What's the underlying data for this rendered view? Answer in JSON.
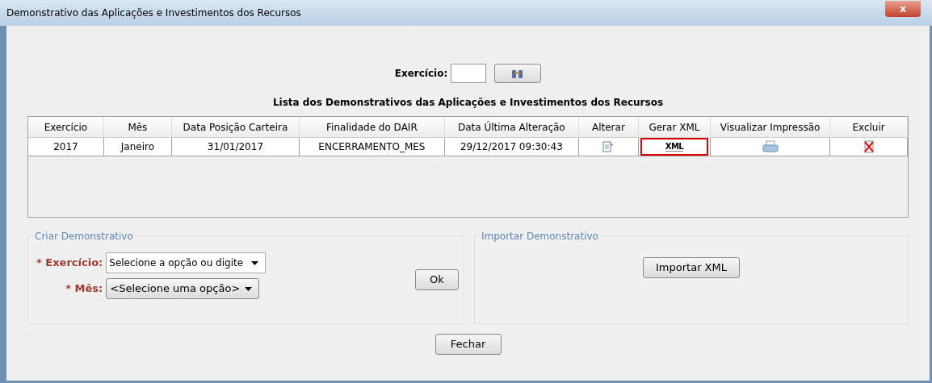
{
  "window": {
    "title": "Demonstrativo das Aplicações e Investimentos dos Recursos",
    "close": "x"
  },
  "filter": {
    "label": "Exercício:"
  },
  "table": {
    "title": "Lista dos Demonstrativos das Aplicações e Investimentos dos Recursos",
    "columns": [
      "Exercício",
      "Mês",
      "Data Posição Carteira",
      "Finalidade do DAIR",
      "Data Última Alteração",
      "Alterar",
      "Gerar XML",
      "Visualizar Impressão",
      "Excluir"
    ],
    "rows": [
      {
        "cells": [
          {
            "kind": "text",
            "text": "2017",
            "highlighted": false
          },
          {
            "kind": "text",
            "text": "Janeiro",
            "highlighted": false
          },
          {
            "kind": "text",
            "text": "31/01/2017",
            "highlighted": false
          },
          {
            "kind": "text",
            "text": "ENCERRAMENTO_MES",
            "highlighted": false
          },
          {
            "kind": "text",
            "text": "29/12/2017 09:30:43",
            "highlighted": false
          },
          {
            "kind": "edit",
            "highlighted": false
          },
          {
            "kind": "xml",
            "text": "XML",
            "highlighted": true
          },
          {
            "kind": "print",
            "highlighted": false
          },
          {
            "kind": "delete",
            "highlighted": false
          }
        ]
      }
    ]
  },
  "create": {
    "legend": "Criar Demonstrativo",
    "fields": [
      {
        "label": "* Exercício:",
        "kind": "combo",
        "value": "Selecione a opção ou digite"
      },
      {
        "label": "* Mês:",
        "kind": "select",
        "value": "<Selecione uma opção>"
      }
    ],
    "button": "Ok"
  },
  "import": {
    "legend": "Importar Demonstrativo",
    "button": "Importar XML"
  },
  "footer": {
    "button": "Fechar"
  }
}
